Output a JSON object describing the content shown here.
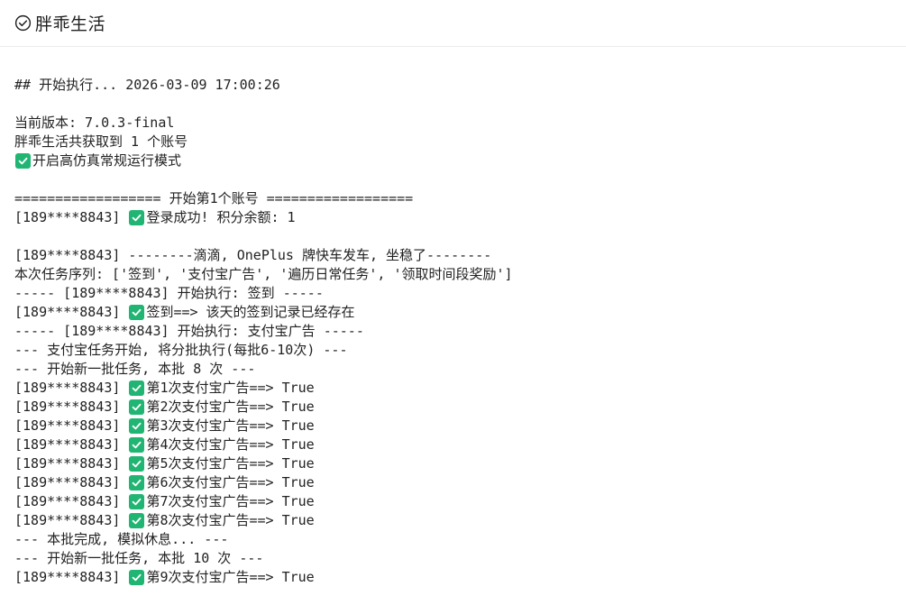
{
  "header": {
    "title": "胖乖生活",
    "icon": "check-circle-icon"
  },
  "colors": {
    "check_green": "#21b573",
    "text": "#222222",
    "divider": "#ececec"
  },
  "log_lines": [
    {
      "text": "## 开始执行... 2026-03-09 17:00:26"
    },
    {
      "text": ""
    },
    {
      "text": "当前版本: 7.0.3-final"
    },
    {
      "text": "胖乖生活共获取到 1 个账号"
    },
    {
      "check": true,
      "text": "开启高仿真常规运行模式"
    },
    {
      "text": ""
    },
    {
      "text": "================== 开始第1个账号 =================="
    },
    {
      "prefix": "[189****8843] ",
      "check": true,
      "text": "登录成功! 积分余额: 1"
    },
    {
      "text": ""
    },
    {
      "text": "[189****8843] --------滴滴, OnePlus 牌快车发车, 坐稳了--------"
    },
    {
      "text": "本次任务序列: ['签到', '支付宝广告', '遍历日常任务', '领取时间段奖励']"
    },
    {
      "text": "----- [189****8843] 开始执行: 签到 -----"
    },
    {
      "prefix": "[189****8843] ",
      "check": true,
      "text": "签到==> 该天的签到记录已经存在"
    },
    {
      "text": "----- [189****8843] 开始执行: 支付宝广告 -----"
    },
    {
      "text": "--- 支付宝任务开始, 将分批执行(每批6-10次) ---"
    },
    {
      "text": "--- 开始新一批任务, 本批 8 次 ---"
    },
    {
      "prefix": "[189****8843] ",
      "check": true,
      "text": "第1次支付宝广告==> True"
    },
    {
      "prefix": "[189****8843] ",
      "check": true,
      "text": "第2次支付宝广告==> True"
    },
    {
      "prefix": "[189****8843] ",
      "check": true,
      "text": "第3次支付宝广告==> True"
    },
    {
      "prefix": "[189****8843] ",
      "check": true,
      "text": "第4次支付宝广告==> True"
    },
    {
      "prefix": "[189****8843] ",
      "check": true,
      "text": "第5次支付宝广告==> True"
    },
    {
      "prefix": "[189****8843] ",
      "check": true,
      "text": "第6次支付宝广告==> True"
    },
    {
      "prefix": "[189****8843] ",
      "check": true,
      "text": "第7次支付宝广告==> True"
    },
    {
      "prefix": "[189****8843] ",
      "check": true,
      "text": "第8次支付宝广告==> True"
    },
    {
      "text": "--- 本批完成, 模拟休息... ---"
    },
    {
      "text": "--- 开始新一批任务, 本批 10 次 ---"
    },
    {
      "prefix": "[189****8843] ",
      "check": true,
      "text": "第9次支付宝广告==> True"
    }
  ]
}
